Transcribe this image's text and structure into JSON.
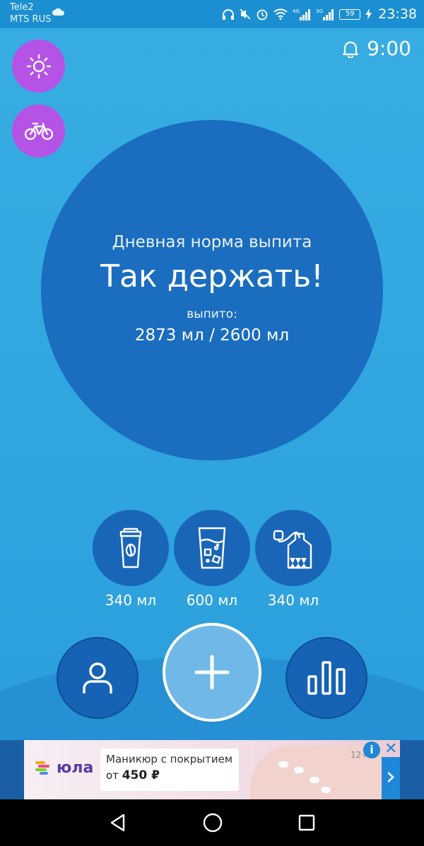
{
  "status_bar": {
    "carrier1": "Tele2",
    "carrier2": "MTS RUS",
    "battery": "59",
    "time": "23:38",
    "net1": "4G",
    "net2": "3G"
  },
  "reminder": {
    "time": "9:00"
  },
  "progress": {
    "subtitle": "Дневная норма выпита",
    "headline": "Так держать!",
    "drunk_label": "выпито:",
    "amount": "2873 мл / 2600 мл"
  },
  "quick_drinks": [
    {
      "icon": "coffee-cup-icon",
      "label": "340 мл"
    },
    {
      "icon": "water-glass-icon",
      "label": "600 мл"
    },
    {
      "icon": "tea-bag-icon",
      "label": "340 мл"
    }
  ],
  "ad": {
    "brand": "юла",
    "line1": "Маникюр с покрытием",
    "line2_prefix": "от",
    "price": "450 ₽",
    "badge": "12+",
    "info": "i",
    "close": "✕",
    "arrow": "›"
  },
  "colors": {
    "background": "#2aa3df",
    "circle": "#1a6dbf",
    "accent_purple": "#b453e6",
    "add_button": "#6fb8e8"
  }
}
